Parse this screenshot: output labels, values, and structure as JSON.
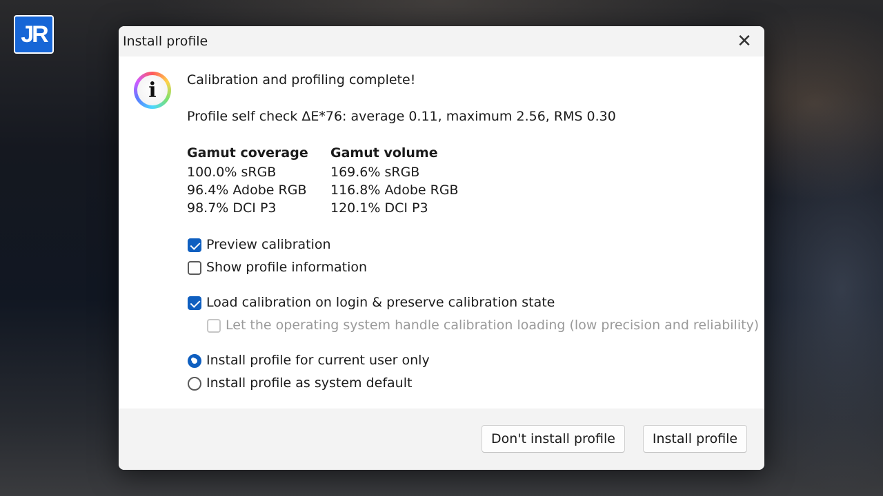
{
  "logo": {
    "text": "JR"
  },
  "dialog": {
    "title": "Install profile",
    "close_glyph": "✕",
    "icon": "info-icon",
    "heading": "Calibration and profiling complete!",
    "self_check": "Profile self check ΔE*76: average 0.11, maximum 2.56, RMS 0.30",
    "coverage": {
      "header": "Gamut coverage",
      "rows": [
        "100.0% sRGB",
        "96.4% Adobe RGB",
        "98.7% DCI P3"
      ]
    },
    "volume": {
      "header": "Gamut volume",
      "rows": [
        "169.6% sRGB",
        "116.8% Adobe RGB",
        "120.1% DCI P3"
      ]
    },
    "checkboxes": [
      {
        "label": "Preview calibration",
        "checked": true,
        "enabled": true
      },
      {
        "label": "Show profile information",
        "checked": false,
        "enabled": true
      },
      {
        "label": "Load calibration on login & preserve calibration state",
        "checked": true,
        "enabled": true
      },
      {
        "label": "Let the operating system handle calibration loading (low precision and reliability)",
        "checked": false,
        "enabled": false
      }
    ],
    "radios": [
      {
        "label": "Install profile for current user only",
        "selected": true
      },
      {
        "label": "Install profile as system default",
        "selected": false
      }
    ],
    "buttons": {
      "dont_install": "Don't install profile",
      "install": "Install profile"
    }
  },
  "colors": {
    "accent": "#0f5fc0",
    "logo_bg": "#1766d6"
  }
}
